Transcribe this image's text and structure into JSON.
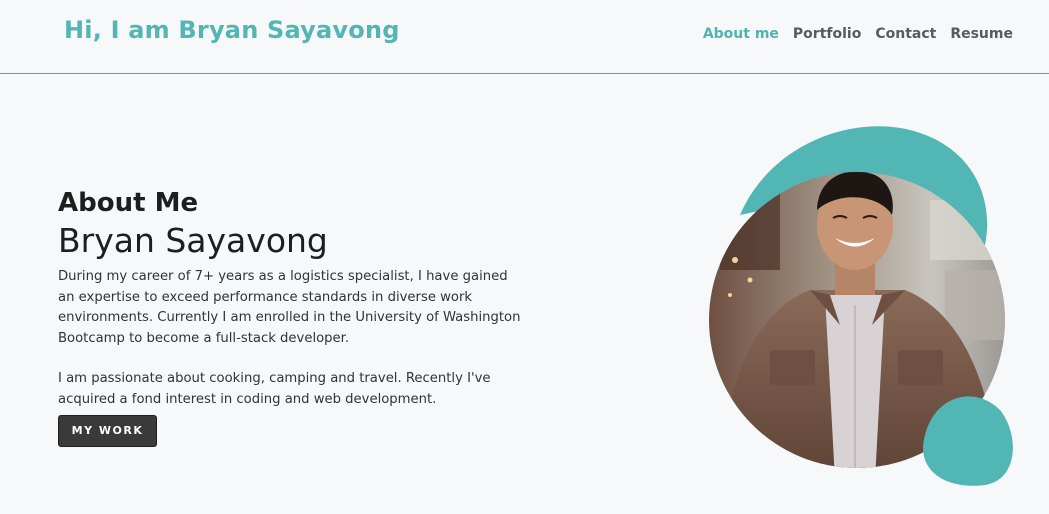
{
  "header": {
    "brand": "Hi, I am Bryan Sayavong",
    "nav": [
      {
        "label": "About me",
        "active": true
      },
      {
        "label": "Portfolio",
        "active": false
      },
      {
        "label": "Contact",
        "active": false
      },
      {
        "label": "Resume",
        "active": false
      }
    ]
  },
  "about": {
    "heading": "About Me",
    "name": "Bryan Sayavong",
    "paragraph1": "During my career of 7+ years as a logistics specialist, I have gained an expertise to exceed performance standards in diverse work environments. Currently I am enrolled in the University of Washington Bootcamp to become a full-stack developer.",
    "paragraph2": "I am passionate about cooking, camping and travel. Recently I've acquired a fond interest in coding and web development.",
    "button_label": "MY WORK"
  },
  "colors": {
    "accent": "#52b6b4",
    "background": "#f6f8f9",
    "button": "#3a3a3a"
  },
  "photo": {
    "icon": "profile-photo"
  }
}
